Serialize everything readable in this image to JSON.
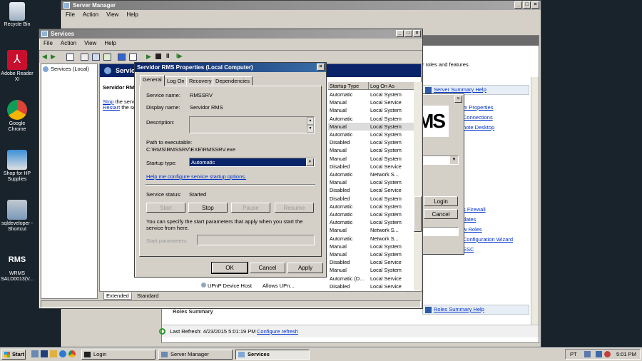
{
  "desktop": {
    "icons": [
      {
        "label": "Recycle Bin"
      },
      {
        "label": "Adobe Reader XI"
      },
      {
        "label": "Google Chrome"
      },
      {
        "label": "Shop for HP Supplies"
      },
      {
        "label": "sqldeveloper - Shortcut"
      },
      {
        "label": "WRMS SALD0013(V..."
      }
    ]
  },
  "server_manager": {
    "title": "Server Manager",
    "menu": [
      "File",
      "Action",
      "View",
      "Help"
    ],
    "roles_text": "r roles and features.",
    "summary_help": "Server Summary Help",
    "links": [
      "m Properties",
      "Connections",
      "note Desktop",
      "s Firewall",
      "dates",
      "w Roles",
      "Configuration Wizard",
      "ESC"
    ],
    "roles_summary_help": "Roles Summary Help",
    "roles_summary": "Roles Summary",
    "last_refresh": "Last Refresh: 4/23/2015 5:01:19 PM",
    "configure_refresh": "Configure refresh"
  },
  "login_dialog": {
    "logo_text": "MS",
    "login": "Login",
    "cancel": "Cancel"
  },
  "services": {
    "title": "Services",
    "menu": [
      "File",
      "Action",
      "View",
      "Help"
    ],
    "tree_item": "Services (Local)",
    "header": "Services",
    "selected_name": "Servidor RM",
    "stop_link": "Stop",
    "stop_rest": " the servi",
    "restart_link": "Restart",
    "restart_rest": " the se",
    "col_startup": "Startup Type",
    "col_logon": "Log On As",
    "rows": [
      {
        "startup": "Automatic",
        "logon": "Local System"
      },
      {
        "startup": "Manual",
        "logon": "Local Service"
      },
      {
        "startup": "Manual",
        "logon": "Local System"
      },
      {
        "startup": "Automatic",
        "logon": "Local System"
      },
      {
        "startup": "Manual",
        "logon": "Local System"
      },
      {
        "startup": "Automatic",
        "logon": "Local System"
      },
      {
        "startup": "Disabled",
        "logon": "Local System"
      },
      {
        "startup": "Manual",
        "logon": "Local System"
      },
      {
        "startup": "Manual",
        "logon": "Local System"
      },
      {
        "startup": "Disabled",
        "logon": "Local Service"
      },
      {
        "startup": "Automatic",
        "logon": "Network S..."
      },
      {
        "startup": "Manual",
        "logon": "Local System"
      },
      {
        "startup": "Disabled",
        "logon": "Local Service"
      },
      {
        "startup": "Disabled",
        "logon": "Local System"
      },
      {
        "startup": "Automatic",
        "logon": "Local System"
      },
      {
        "startup": "Automatic",
        "logon": "Local System"
      },
      {
        "startup": "Automatic",
        "logon": "Local System"
      },
      {
        "startup": "Manual",
        "logon": "Network S..."
      },
      {
        "startup": "Automatic",
        "logon": "Network S..."
      },
      {
        "startup": "Manual",
        "logon": "Local System"
      },
      {
        "startup": "Manual",
        "logon": "Local System"
      },
      {
        "startup": "Disabled",
        "logon": "Local Service"
      },
      {
        "startup": "Manual",
        "logon": "Local System"
      },
      {
        "startup": "Automatic (D...",
        "logon": "Local Service"
      },
      {
        "startup": "Disabled",
        "logon": "Local Service"
      }
    ],
    "bottom_name": "UPnP Device Host",
    "bottom_desc": "Allows UPn...",
    "tab_extended": "Extended",
    "tab_standard": "Standard"
  },
  "props": {
    "title": "Servidor RMS Properties (Local Computer)",
    "tabs": [
      "General",
      "Log On",
      "Recovery",
      "Dependencies"
    ],
    "service_name_label": "Service name:",
    "service_name": "RMSSRV",
    "display_name_label": "Display name:",
    "display_name": "Servidor RMS",
    "description_label": "Description:",
    "path_label": "Path to executable:",
    "path": "C:\\RMS\\RMSSRV\\EXE\\RMSSRV.exe",
    "startup_type_label": "Startup type:",
    "startup_type": "Automatic",
    "help_link": "Help me configure service startup options.",
    "status_label": "Service status:",
    "status": "Started",
    "btn_start": "Start",
    "btn_stop": "Stop",
    "btn_pause": "Pause",
    "btn_resume": "Resume",
    "params_note": "You can specify the start parameters that apply when you start the service from here.",
    "params_label": "Start parameters:",
    "ok": "OK",
    "cancel": "Cancel",
    "apply": "Apply"
  },
  "taskbar": {
    "start": "Start",
    "tasks": [
      "Login",
      "Server Manager",
      "Services"
    ],
    "lang": "PT",
    "clock": "5:01 PM"
  },
  "colors": {
    "desktop": "#19232c",
    "titlebar_active": "#0a246a",
    "window": "#d4d0c8",
    "link": "#0033cc"
  }
}
